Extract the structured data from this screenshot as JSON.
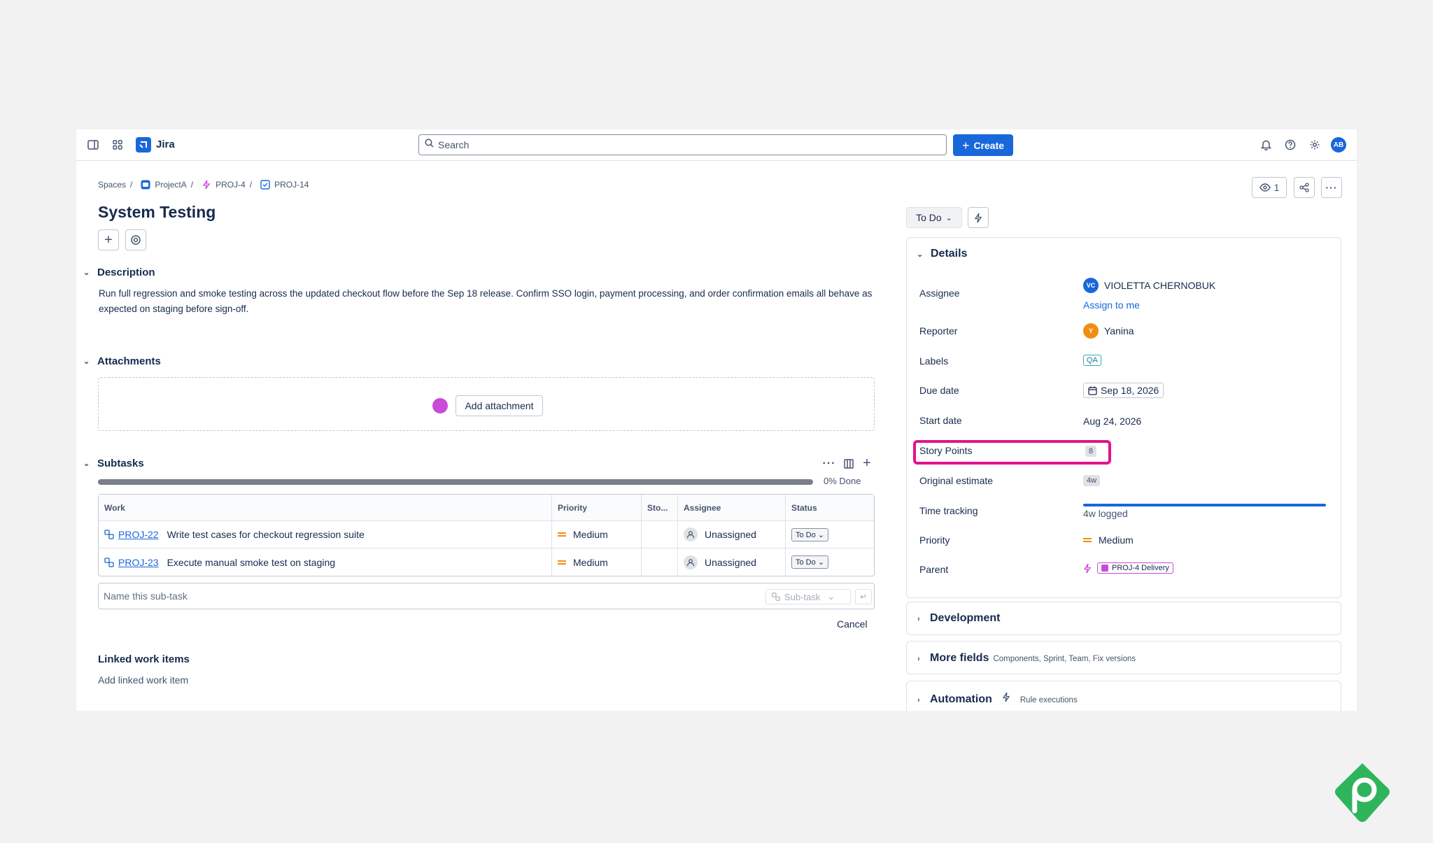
{
  "app": {
    "name": "Jira"
  },
  "search": {
    "placeholder": "Search"
  },
  "toolbar": {
    "create_label": "Create",
    "avatar_initials": "AB"
  },
  "breadcrumb": {
    "items": [
      "Spaces",
      "ProjectA",
      "PROJ-4",
      "PROJ-14"
    ],
    "separator": "/"
  },
  "issue": {
    "title": "System Testing",
    "watchers_count": "1"
  },
  "description": {
    "heading": "Description",
    "text": "Run full regression and smoke testing across the updated checkout flow before the Sep 18 release. Confirm SSO login, payment processing, and order confirmation emails all behave as expected on staging before sign-off."
  },
  "attachments": {
    "heading": "Attachments",
    "add_label": "Add attachment"
  },
  "subtasks": {
    "heading": "Subtasks",
    "progress_text": "0% Done",
    "progress_fraction": 0,
    "columns": [
      "Work",
      "Priority",
      "Sto...",
      "Assignee",
      "Status"
    ],
    "rows": [
      {
        "key": "PROJ-22",
        "summary": "Write test cases for checkout regression suite",
        "priority": "Medium",
        "assignee": "Unassigned",
        "status": "To Do"
      },
      {
        "key": "PROJ-23",
        "summary": "Execute manual smoke test on staging",
        "priority": "Medium",
        "assignee": "Unassigned",
        "status": "To Do"
      }
    ],
    "new_placeholder": "Name this sub-task",
    "type_label": "Sub-task",
    "enter_glyph": "↵",
    "cancel_label": "Cancel"
  },
  "linked": {
    "heading": "Linked work items",
    "add_label": "Add linked work item"
  },
  "status_button": {
    "label": "To Do"
  },
  "details": {
    "heading": "Details",
    "assignee": {
      "label": "Assignee",
      "name": "VIOLETTA CHERNOBUK",
      "initials": "VC",
      "assign_to_me": "Assign to me"
    },
    "reporter": {
      "label": "Reporter",
      "name": "Yanina",
      "initials": "Y"
    },
    "labels": {
      "label": "Labels",
      "value": "QA"
    },
    "due_date": {
      "label": "Due date",
      "value": "Sep 18, 2026"
    },
    "start_date": {
      "label": "Start date",
      "value": "Aug 24, 2026"
    },
    "story_points": {
      "label": "Story Points",
      "value": "8"
    },
    "original_estimate": {
      "label": "Original estimate",
      "value": "4w"
    },
    "time_tracking": {
      "label": "Time tracking",
      "value": "4w logged",
      "fraction": 1
    },
    "priority": {
      "label": "Priority",
      "value": "Medium"
    },
    "parent": {
      "label": "Parent",
      "value": "PROJ-4 Delivery"
    }
  },
  "panels": {
    "development": {
      "title": "Development"
    },
    "more_fields": {
      "title": "More fields",
      "subtitle": "Components, Sprint, Team, Fix versions"
    },
    "automation": {
      "title": "Automation",
      "subtitle": "Rule executions"
    }
  },
  "colors": {
    "brand": "#1868db",
    "highlight": "#e2138c",
    "priority_medium": "#f18d13",
    "reporter_avatar": "#f18d13",
    "epic": "#c94bd6",
    "watermark": "#2fb45c"
  }
}
